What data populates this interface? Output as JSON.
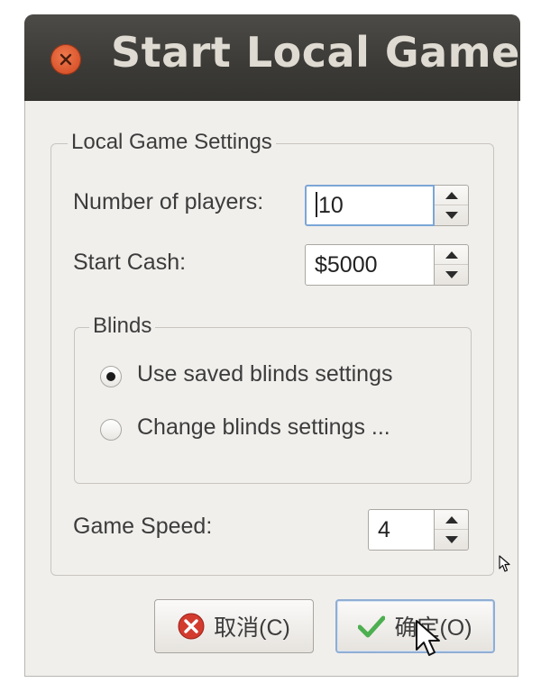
{
  "window": {
    "title": "Start Local Game"
  },
  "settings": {
    "legend": "Local Game Settings",
    "players_label": "Number of players:",
    "players_value": "10",
    "cash_label": "Start Cash:",
    "cash_value": "$5000",
    "speed_label": "Game Speed:",
    "speed_value": "4"
  },
  "blinds": {
    "legend": "Blinds",
    "option_saved": "Use saved blinds settings",
    "option_change": "Change blinds settings ...",
    "selected": "option_saved"
  },
  "buttons": {
    "cancel_label": "取消(C)",
    "ok_label": "确定(O)"
  },
  "colors": {
    "titlebar": "#3c3b37",
    "close": "#df5a2f",
    "focus_border": "#7ba6d6",
    "ok_check": "#4caf50",
    "cancel_icon": "#d33b2f"
  }
}
